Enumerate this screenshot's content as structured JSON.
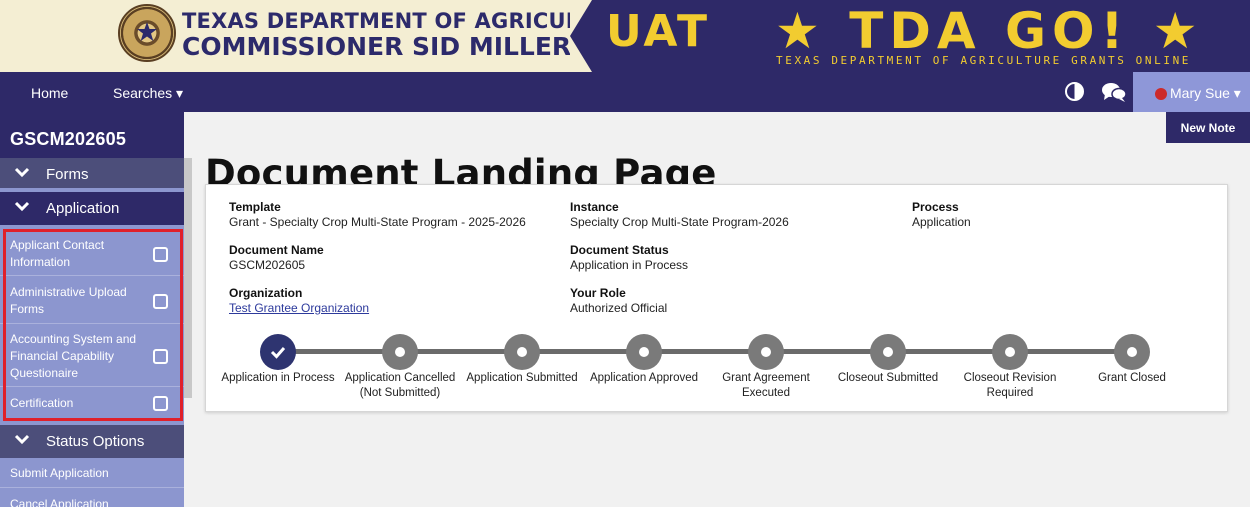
{
  "banner": {
    "agency_line1": "TEXAS DEPARTMENT OF AGRICULTURE",
    "agency_line2": "COMMISSIONER SID MILLER",
    "env_label": "UAT",
    "app_logo": "★ TDA GO! ★",
    "app_tagline": "TEXAS DEPARTMENT OF AGRICULTURE GRANTS ONLINE",
    "seal_icon": "texas-seal"
  },
  "nav": {
    "home": "Home",
    "searches": "Searches ▾",
    "user": "Mary Sue ▾",
    "colors": {
      "bar": "#2e2968",
      "user_box": "#8e97d8",
      "status": "#cc2a2a"
    }
  },
  "sidebar": {
    "doc_id": "GSCM202605",
    "forms_label": "Forms",
    "application_label": "Application",
    "items": [
      {
        "label": "Applicant Contact Information",
        "checked": false
      },
      {
        "label": "Administrative Upload Forms",
        "checked": false
      },
      {
        "label": "Accounting System and Financial Capability Questionaire",
        "checked": false
      },
      {
        "label": "Certification",
        "checked": false
      }
    ],
    "status_label": "Status Options",
    "status_items": [
      "Submit Application",
      "Cancel Application"
    ]
  },
  "main": {
    "new_note": "New Note",
    "title": "Document Landing Page",
    "fields": {
      "template_label": "Template",
      "template_value": "Grant - Specialty Crop Multi-State Program - 2025-2026",
      "instance_label": "Instance",
      "instance_value": "Specialty Crop Multi-State Program-2026",
      "process_label": "Process",
      "process_value": "Application",
      "docname_label": "Document Name",
      "docname_value": "GSCM202605",
      "docstatus_label": "Document Status",
      "docstatus_value": "Application in Process",
      "org_label": "Organization",
      "org_value": "Test Grantee Organization",
      "role_label": "Your Role",
      "role_value": "Authorized Official"
    },
    "steps": [
      {
        "line1": "Application in Process",
        "line2": "",
        "done": true
      },
      {
        "line1": "Application Cancelled",
        "line2": "(Not Submitted)",
        "done": false
      },
      {
        "line1": "Application Submitted",
        "line2": "",
        "done": false
      },
      {
        "line1": "Application Approved",
        "line2": "",
        "done": false
      },
      {
        "line1": "Grant Agreement",
        "line2": "Executed",
        "done": false
      },
      {
        "line1": "Closeout Submitted",
        "line2": "",
        "done": false
      },
      {
        "line1": "Closeout Revision",
        "line2": "Required",
        "done": false
      },
      {
        "line1": "Grant Closed",
        "line2": "",
        "done": false
      }
    ]
  }
}
